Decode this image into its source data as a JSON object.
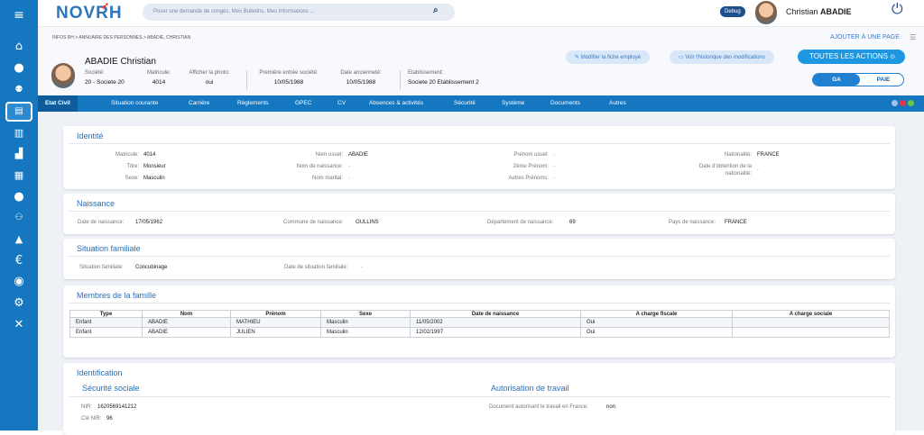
{
  "topbar": {
    "logo": "NOVRH",
    "search_placeholder": "Poser une demande de congés, Mes Bulletins, Mes Informations ...",
    "debug": "Debug",
    "user_first": "Christian",
    "user_last": "ABADIE"
  },
  "header": {
    "breadcrumb": "INFOS RH  >  ANNUAIRE DES PERSONNES  >  ABADIE, CHRISTIAN",
    "add_page": "AJOUTER À UNE PAGE",
    "employee_name": "ABADIE  Christian",
    "fields": [
      {
        "label": "Société:",
        "value": "20 - Societe 20"
      },
      {
        "label": "Matricule:",
        "value": "4014"
      },
      {
        "label": "Afficher la photo:",
        "value": "oui"
      },
      {
        "label": "Première entrée société:",
        "value": "10/05/1988"
      },
      {
        "label": "Date ancienneté:",
        "value": "10/05/1988"
      },
      {
        "label": "Etablissement:",
        "value": "Societe 20 Etablissement 2"
      }
    ],
    "btn_modify": "Modifier la fiche employé",
    "btn_history": "Voir l'historique des modifications",
    "btn_actions": "TOUTES LES ACTIONS",
    "toggle_ga": "GA",
    "toggle_paie": "PAIE"
  },
  "tabs": [
    "Etat Civil",
    "Situation courante",
    "Carrière",
    "Règlements",
    "GPEC",
    "CV",
    "Absences & activités",
    "Sécurité",
    "Système",
    "Documents",
    "Autres"
  ],
  "identite": {
    "title": "Identité",
    "matricule_label": "Matricule:",
    "matricule": "4014",
    "titre_label": "Titre:",
    "titre": "Monsieur",
    "sexe_label": "Sexe:",
    "sexe": "Masculin",
    "nom_usuel_label": "Nom usuel:",
    "nom_usuel": "ABADIE",
    "nom_naissance_label": "Nom de naissance:",
    "nom_naissance": "-",
    "nom_marital_label": "Nom marital:",
    "nom_marital": "-",
    "prenom_usuel_label": "Prénom usuel:",
    "prenom_usuel": "-",
    "prenom2_label": "2ème Prénom:",
    "prenom2": "-",
    "autres_prenoms_label": "Autres Prénoms:",
    "autres_prenoms": "-",
    "nationalite_label": "Nationalité:",
    "nationalite": "FRANCE",
    "date_obtention_label_1": "Date d'obtention de la",
    "date_obtention_label_2": "nationalité:",
    "date_obtention": "-"
  },
  "naissance": {
    "title": "Naissance",
    "date_label": "Date de naissance:",
    "date": "17/05/1962",
    "commune_label": "Commune de naissance:",
    "commune": "OULLINS",
    "departement_label": "Département de naissance:",
    "departement": "69",
    "pays_label": "Pays de naissance:",
    "pays": "FRANCE"
  },
  "situation": {
    "title": "Situation familiale",
    "situation_label": "Situation familiale:",
    "situation": "Concubinage",
    "date_label": "Date de situation familiale:",
    "date": "-"
  },
  "famille": {
    "title": "Membres de la famille",
    "columns": [
      "Type",
      "Nom",
      "Prénom",
      "Sexe",
      "Date de naissance",
      "A charge fiscale",
      "A charge sociale"
    ],
    "rows": [
      [
        "Enfant",
        "ABADIE",
        "MATHIEU",
        "Masculin",
        "11/05/2002",
        "Oui",
        ""
      ],
      [
        "Enfant",
        "ABADIE",
        "JULIEN",
        "Masculin",
        "12/02/1997",
        "Oui",
        ""
      ]
    ]
  },
  "identification": {
    "title": "Identification",
    "secu_title": "Sécurité sociale",
    "nir_label": "NIR:",
    "nir": "1620569141212",
    "cle_label": "Clé NIR:",
    "cle": "96",
    "travail_title": "Autorisation de travail",
    "doc_label": "Document autorisant le travail en France:",
    "doc": "non"
  }
}
